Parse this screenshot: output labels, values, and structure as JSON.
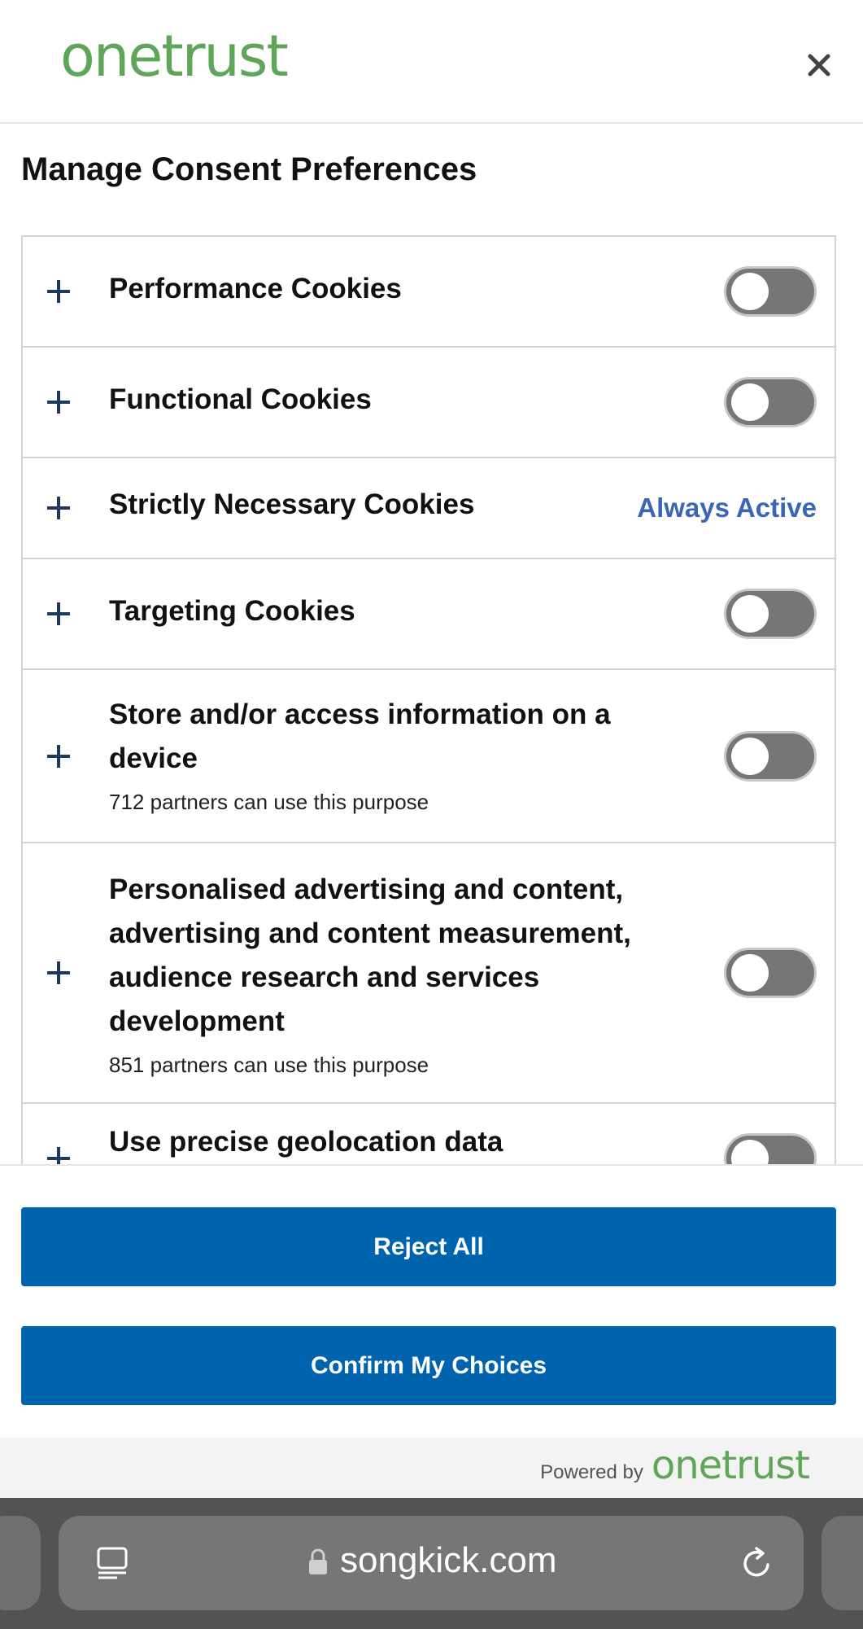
{
  "header": {
    "logo_text": "onetrust",
    "close_icon": "close-icon"
  },
  "title": "Manage Consent Preferences",
  "categories": [
    {
      "label": "Performance Cookies",
      "control": "toggle",
      "state": "off"
    },
    {
      "label": "Functional Cookies",
      "control": "toggle",
      "state": "off"
    },
    {
      "label": "Strictly Necessary Cookies",
      "control": "status",
      "status_text": "Always Active"
    },
    {
      "label": "Targeting Cookies",
      "control": "toggle",
      "state": "off"
    },
    {
      "label": "Store and/or access information on a device",
      "sub": "712 partners can use this purpose",
      "control": "toggle",
      "state": "off"
    },
    {
      "label": "Personalised advertising and content, advertising and content measurement, audience research and services development",
      "sub": "851 partners can use this purpose",
      "control": "toggle",
      "state": "off"
    },
    {
      "label": "Use precise geolocation data",
      "control": "toggle",
      "state": "off"
    }
  ],
  "buttons": {
    "reject_all": "Reject All",
    "confirm": "Confirm My Choices"
  },
  "footer": {
    "powered_by": "Powered by",
    "logo_text": "onetrust"
  },
  "browser": {
    "url": "songkick.com",
    "icons": [
      "reader-icon",
      "lock-icon",
      "reload-icon"
    ]
  },
  "colors": {
    "brand_green": "#5fa55a",
    "button_blue": "#0063ad",
    "always_active": "#3a66b5",
    "toggle_off": "#767676"
  }
}
